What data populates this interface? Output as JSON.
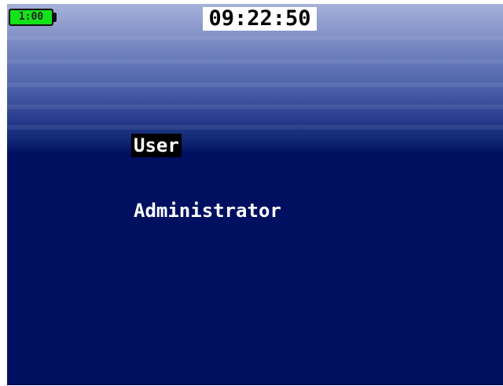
{
  "status_bar": {
    "battery_label": "1:00",
    "time": "09:22:50"
  },
  "menu": {
    "items": [
      {
        "label": "User",
        "selected": true
      },
      {
        "label": "Administrator",
        "selected": false
      }
    ]
  },
  "colors": {
    "background": "#001060",
    "gradient_top": "#a7b2da",
    "battery": "#14e31a",
    "text": "#ffffff",
    "selection": "#000000"
  }
}
